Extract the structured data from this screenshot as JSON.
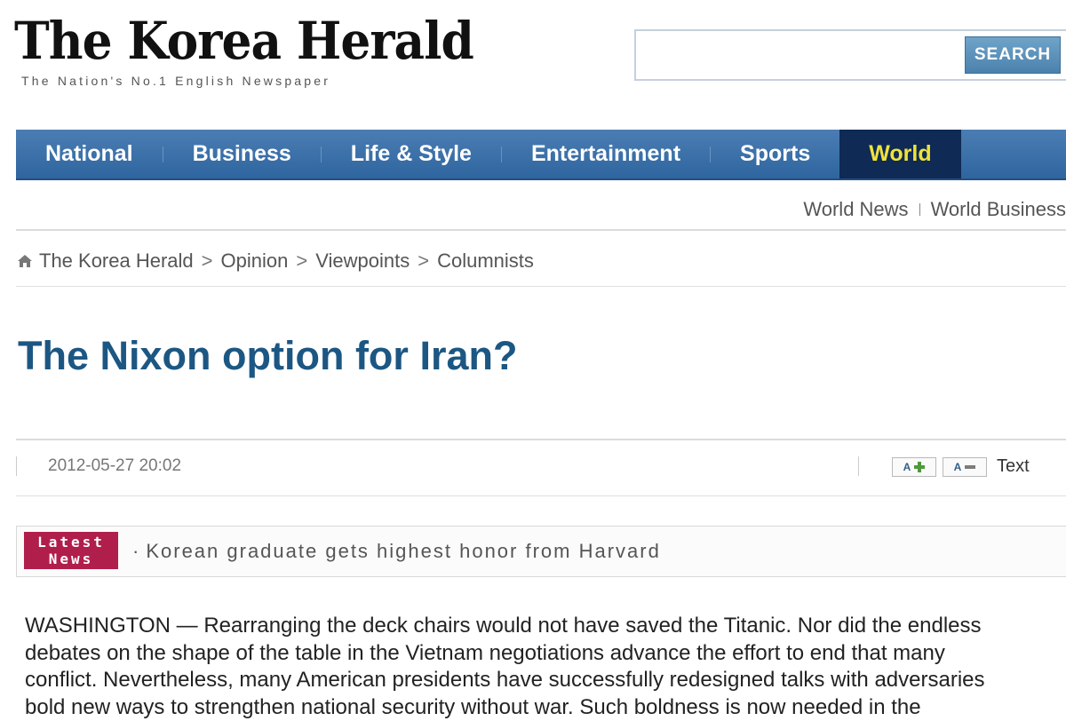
{
  "header": {
    "logo_text": "The Korea Herald",
    "tagline": "The Nation's No.1 English Newspaper",
    "search": {
      "value": "",
      "placeholder": "",
      "button_label": "SEARCH"
    }
  },
  "nav": {
    "items": [
      {
        "label": "National"
      },
      {
        "label": "Business"
      },
      {
        "label": "Life & Style"
      },
      {
        "label": "Entertainment"
      },
      {
        "label": "Sports"
      },
      {
        "label": "World",
        "active": true
      }
    ]
  },
  "subnav": {
    "items": [
      {
        "label": "World News"
      },
      {
        "label": "World Business"
      }
    ]
  },
  "breadcrumb": {
    "items": [
      "The Korea Herald",
      "Opinion",
      "Viewpoints",
      "Columnists"
    ],
    "separator": ">"
  },
  "article": {
    "title": "The Nixon option for Iran?",
    "date": "2012-05-27 20:02",
    "font_increase_label": "A",
    "font_decrease_label": "A",
    "text_label": "Text",
    "body_lines": [
      "WASHINGTON — Rearranging the deck chairs would not have saved the Titanic. Nor did the endless",
      "debates on the shape of the table in the Vietnam negotiations advance the effort to end that many",
      "conflict. Nevertheless, many American presidents have successfully redesigned talks with adversaries",
      "bold new ways to strengthen national security without war. Such boldness is now needed in the"
    ]
  },
  "latest_news": {
    "badge_line1": "Latest",
    "badge_line2": "News",
    "headline": "Korean graduate gets highest honor from Harvard"
  },
  "colors": {
    "nav_bg": "#3a6fa8",
    "nav_active_bg": "#0f2a55",
    "nav_active_text": "#f0e23c",
    "title": "#1c5783",
    "latest_badge": "#b01e4c",
    "search_button": "#5b90bb"
  }
}
